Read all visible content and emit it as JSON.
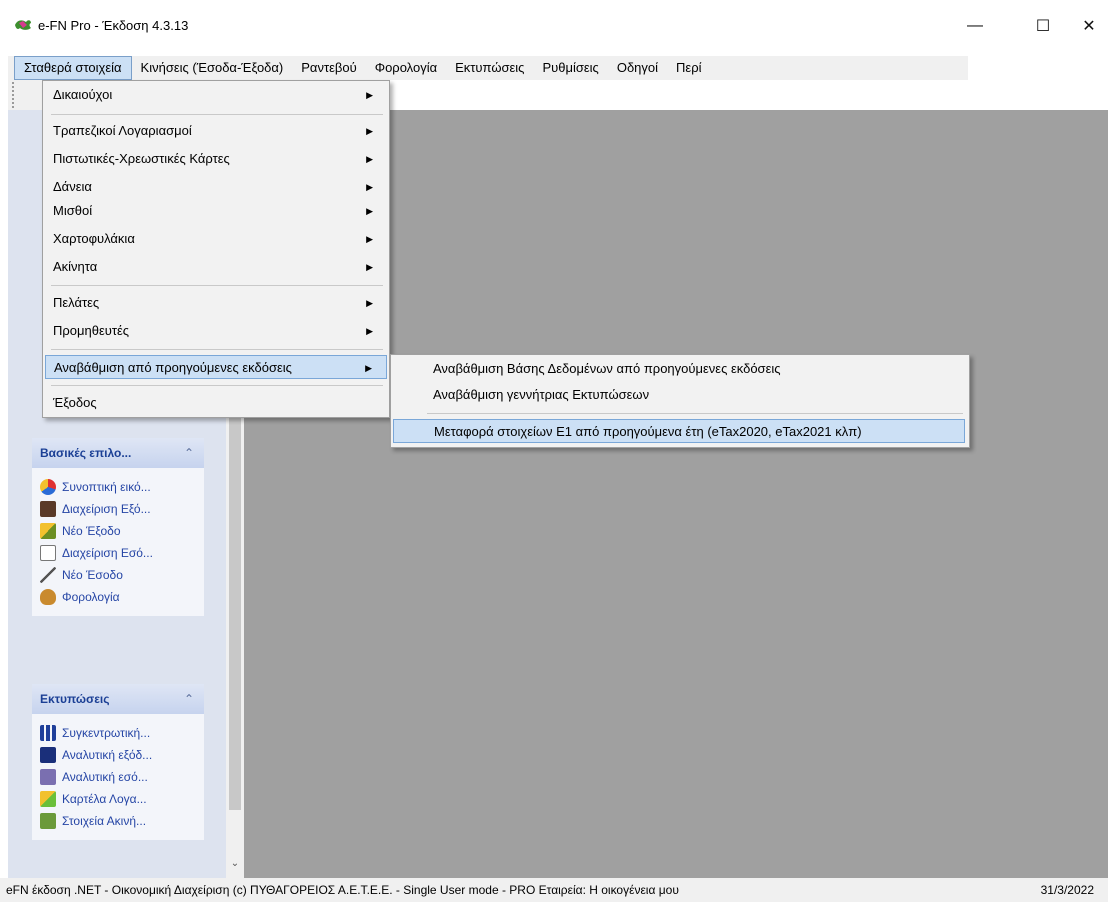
{
  "window": {
    "title": "e-FN Pro  - Έκδοση 4.3.13",
    "minimize": "—",
    "maximize": "☐",
    "close": "✕"
  },
  "menubar": [
    "Σταθερά στοιχεία",
    "Κινήσεις (Έσοδα-Έξοδα)",
    "Ραντεβού",
    "Φορολογία",
    "Εκτυπώσεις",
    "Ρυθμίσεις",
    "Οδηγοί",
    "Περί"
  ],
  "dropdown": {
    "items": [
      {
        "label": "Δικαιούχοι",
        "submenu": true
      },
      {
        "label": "Τραπεζικοί Λογαριασμοί",
        "submenu": true
      },
      {
        "label": "Πιστωτικές-Χρεωστικές Κάρτες",
        "submenu": true
      },
      {
        "label": "Δάνεια",
        "submenu": true
      },
      {
        "label": "Μισθοί",
        "submenu": true
      },
      {
        "label": "Χαρτοφυλάκια",
        "submenu": true
      },
      {
        "label": "Ακίνητα",
        "submenu": true
      },
      {
        "label": "Πελάτες",
        "submenu": true
      },
      {
        "label": "Προμηθευτές",
        "submenu": true
      },
      {
        "label": "Αναβάθμιση από προηγούμενες εκδόσεις",
        "submenu": true
      },
      {
        "label": "Έξοδος",
        "submenu": false
      }
    ],
    "arrow": "▶"
  },
  "submenu": {
    "items": [
      "Αναβάθμιση Βάσης Δεδομένων από προηγούμενες εκδόσεις",
      "Αναβάθμιση γεννήτριας Εκτυπώσεων",
      "Μεταφορά στοιχείων Ε1 από προηγούμενα έτη (eTax2020, eTax2021 κλπ)"
    ]
  },
  "left_panel": {
    "group1": {
      "title": "Βασικές επιλο...",
      "chevron": "⌃",
      "items": [
        {
          "label": "Συνοπτική εικό...",
          "icon": "pie-icon"
        },
        {
          "label": "Διαχείριση Εξό...",
          "icon": "wallet-icon"
        },
        {
          "label": "Νέο Έξοδο",
          "icon": "pencil-icon"
        },
        {
          "label": "Διαχείριση Εσό...",
          "icon": "list-icon"
        },
        {
          "label": "Νέο Έσοδο",
          "icon": "chart-line-icon"
        },
        {
          "label": "Φορολογία",
          "icon": "money-bag-icon"
        }
      ]
    },
    "group2": {
      "title": "Εκτυπώσεις",
      "chevron": "⌃",
      "items": [
        {
          "label": "Συγκεντρωτική...",
          "icon": "bar-chart-icon"
        },
        {
          "label": "Αναλυτική εξόδ...",
          "icon": "report-icon"
        },
        {
          "label": "Αναλυτική εσό...",
          "icon": "report-in-icon"
        },
        {
          "label": "Καρτέλα Λογα...",
          "icon": "card-icon"
        },
        {
          "label": "Στοιχεία Ακινή...",
          "icon": "house-icon"
        }
      ]
    },
    "scroll_down": "⌄"
  },
  "statusbar": {
    "text": "eFN έκδοση .NET - Οικονομική Διαχείριση  (c) ΠΥΘΑΓΟΡΕΙΟΣ Α.Ε.Τ.Ε.Ε. - Single User mode - PRO  Εταιρεία: Η οικογένεια μου",
    "date": "31/3/2022"
  }
}
